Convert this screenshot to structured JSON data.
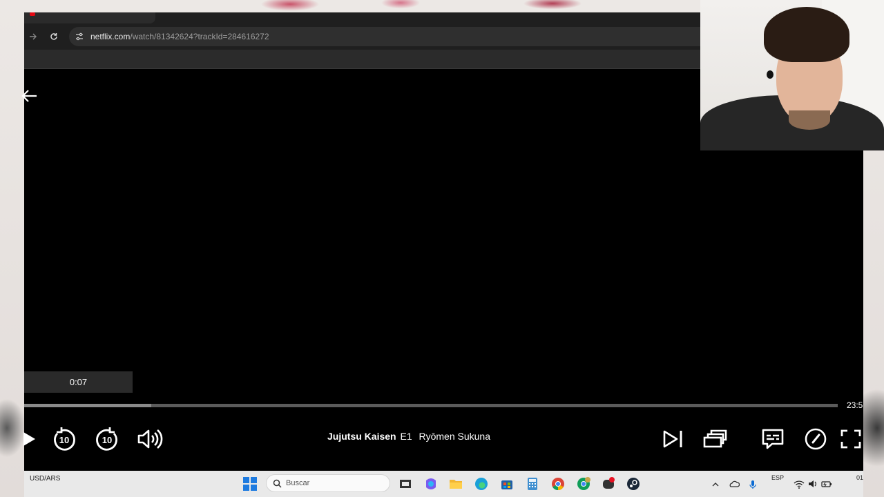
{
  "browser": {
    "url_host": "netflix.com",
    "url_path": "/watch/81342624?trackId=284616272"
  },
  "player": {
    "hover_time": "0:07",
    "duration": "23:5",
    "progress_fraction": 0.156,
    "title": {
      "show": "Jujutsu Kaisen",
      "episode": "E1",
      "episode_name": "Ryōmen Sukuna"
    },
    "controls": {
      "play": "play-icon",
      "back10": "10",
      "forward10": "10",
      "volume": "volume-icon",
      "next": "next-episode-icon",
      "episodes": "episodes-icon",
      "subtitles": "subtitles-icon",
      "speed": "playback-speed-icon",
      "fullscreen": "fullscreen-icon"
    }
  },
  "taskbar": {
    "currency": "USD/ARS",
    "search_label": "Buscar",
    "language": "ESP",
    "clock": "01"
  },
  "colors": {
    "accent": "#e50914",
    "player_bg": "#000000",
    "progress": "#5b5b5b"
  }
}
